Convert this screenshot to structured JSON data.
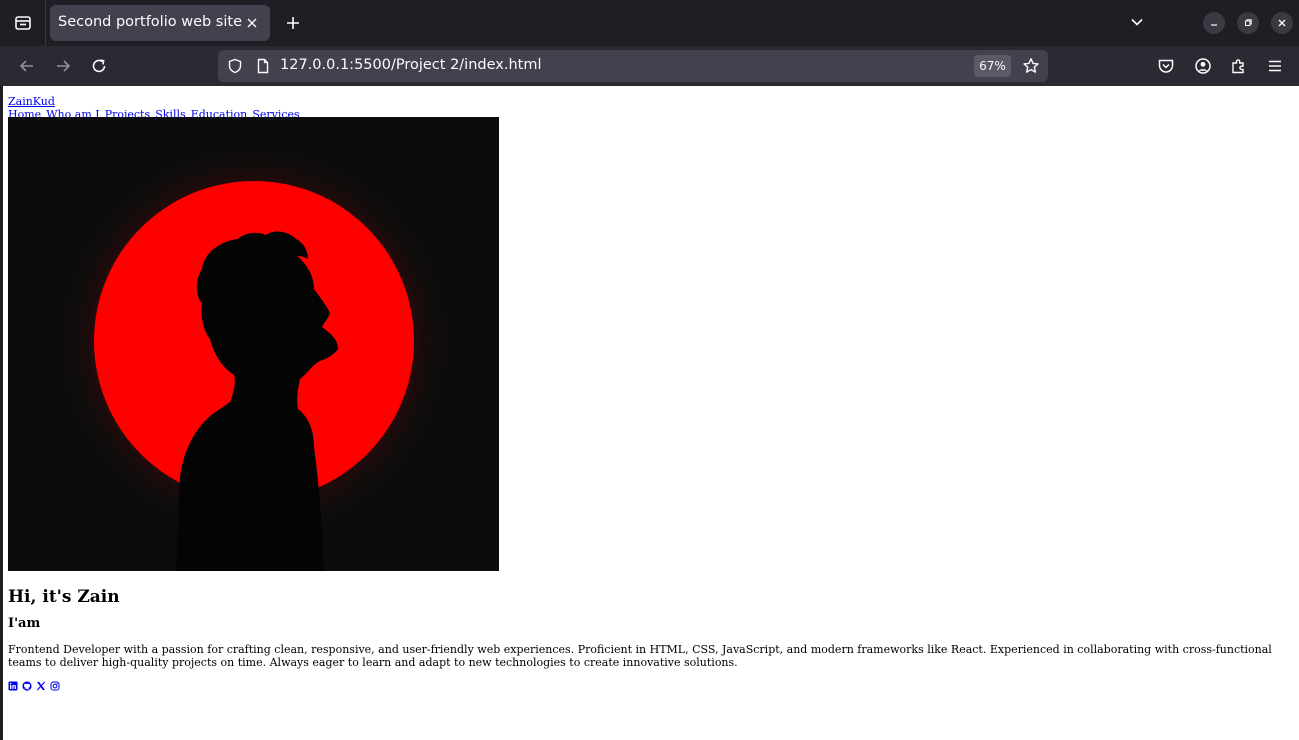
{
  "browser": {
    "tab_title": "Second portfolio web site",
    "url": "127.0.0.1:5500/Project 2/index.html",
    "zoom": "67%"
  },
  "page": {
    "logo": "ZainKud",
    "nav": [
      "Home",
      "Who am I",
      "Projects",
      "Skills",
      "Education",
      "Services"
    ],
    "hero_title": "Hi, it's Zain",
    "hero_subtitle": "I'am",
    "hero_text": "Frontend Developer with a passion for crafting clean, responsive, and user-friendly web experiences. Proficient in HTML, CSS, JavaScript, and modern frameworks like React. Experienced in collaborating with cross-functional teams to deliver high-quality projects on time. Always eager to learn and adapt to new technologies to create innovative solutions.",
    "social_icons": [
      "linkedin-icon",
      "github-icon",
      "x-icon",
      "instagram-icon"
    ]
  },
  "colors": {
    "link": "#0000ee",
    "tabbar_bg": "#1f1e25",
    "navbar_bg": "#2b2a33",
    "hero_circle": "#ff0000"
  }
}
